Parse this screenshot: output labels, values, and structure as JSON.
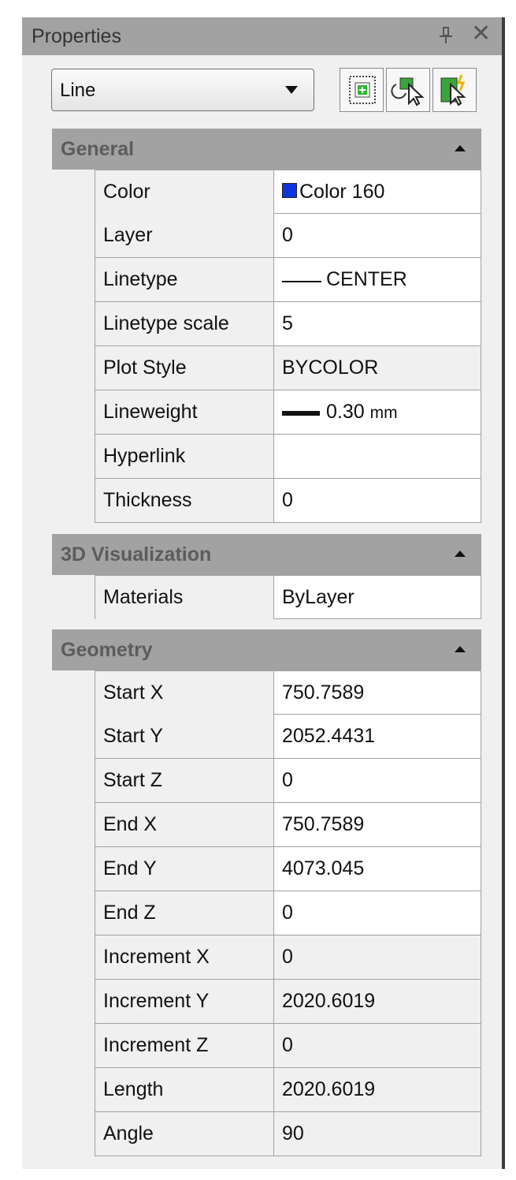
{
  "panel": {
    "title": "Properties",
    "pin_icon": "pin-icon",
    "close_icon": "close-icon",
    "close_glyph": "✕"
  },
  "selector": {
    "value": "Line",
    "toolbar_icons": [
      "quick-select-icon",
      "select-objects-icon",
      "toggle-pickadd-icon"
    ]
  },
  "colors": {
    "header_bg": "#a2a2a2",
    "section_text": "#5c5c5c",
    "color_swatch": "#1133dd"
  },
  "sections": {
    "general": {
      "label": "General",
      "rows": [
        {
          "name": "Color",
          "value": "Color 160"
        },
        {
          "name": "Layer",
          "value": "0"
        },
        {
          "name": "Linetype",
          "value": "CENTER"
        },
        {
          "name": "Linetype scale",
          "value": "5"
        },
        {
          "name": "Plot Style",
          "value": "BYCOLOR"
        },
        {
          "name": "Lineweight",
          "value": "0.30",
          "unit": "mm"
        },
        {
          "name": "Hyperlink",
          "value": ""
        },
        {
          "name": "Thickness",
          "value": "0"
        }
      ]
    },
    "visualization": {
      "label": "3D Visualization",
      "rows": [
        {
          "name": "Materials",
          "value": "ByLayer"
        }
      ]
    },
    "geometry": {
      "label": "Geometry",
      "rows": [
        {
          "name": "Start X",
          "value": "750.7589"
        },
        {
          "name": "Start Y",
          "value": "2052.4431"
        },
        {
          "name": "Start Z",
          "value": "0"
        },
        {
          "name": "End X",
          "value": "750.7589"
        },
        {
          "name": "End Y",
          "value": "4073.045"
        },
        {
          "name": "End Z",
          "value": "0"
        },
        {
          "name": "Increment X",
          "value": "0"
        },
        {
          "name": "Increment Y",
          "value": "2020.6019"
        },
        {
          "name": "Increment Z",
          "value": "0"
        },
        {
          "name": "Length",
          "value": "2020.6019"
        },
        {
          "name": "Angle",
          "value": "90"
        }
      ]
    }
  }
}
